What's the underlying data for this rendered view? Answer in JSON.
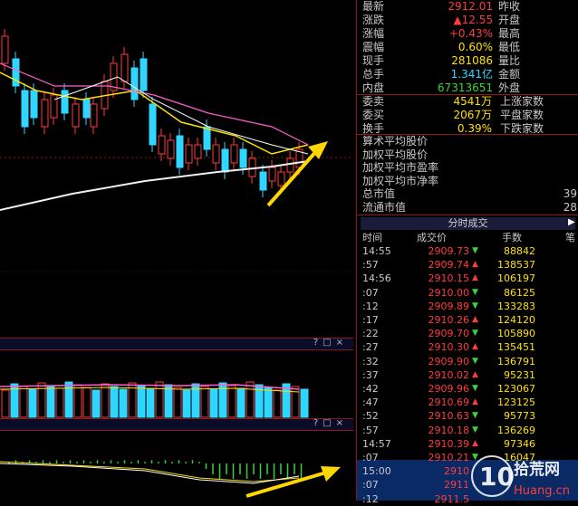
{
  "quote": {
    "rows": [
      {
        "label": "最新",
        "value": "2912.01",
        "color": "#ff3c3c",
        "label2": "昨收"
      },
      {
        "label": "涨跌",
        "value": "▲12.55",
        "color": "#ff3c3c",
        "label2": "开盘"
      },
      {
        "label": "涨幅",
        "value": "+0.43%",
        "color": "#ff3c3c",
        "label2": "最高"
      },
      {
        "label": "震幅",
        "value": "0.60%",
        "color": "#ffe000",
        "label2": "最低"
      },
      {
        "label": "现手",
        "value": "281086",
        "color": "#ffe000",
        "label2": "量比"
      },
      {
        "label": "总手",
        "value": "1.341亿",
        "color": "#2fd6ff",
        "label2": "金额"
      },
      {
        "label": "内盘",
        "value": "67313651",
        "color": "#3cd23c",
        "label2": "外盘"
      }
    ],
    "breadth": [
      {
        "label": "委卖",
        "value": "4541万",
        "label2": "上涨家数"
      },
      {
        "label": "委买",
        "value": "2067万",
        "label2": "平盘家数"
      },
      {
        "label": "换手",
        "value": "0.39%",
        "label2": "下跌家数"
      }
    ]
  },
  "index_info": {
    "rows": [
      "算术平均股价",
      "加权平均股价",
      "加权平均市盈率",
      "加权平均市净率",
      "总市值",
      "流通市值"
    ],
    "total_cap_partial": "39",
    "float_cap_partial": "28"
  },
  "ticks": {
    "title": "分时成交",
    "headers": {
      "time": "时间",
      "price": "成交价",
      "vol": "手数",
      "extra": "笔"
    },
    "rows": [
      {
        "t": "14:55",
        "p": "2909.73",
        "dir": "down",
        "v": "88842"
      },
      {
        "t": ":57",
        "p": "2909.74",
        "dir": "up",
        "v": "138537"
      },
      {
        "t": "14:56",
        "p": "2910.15",
        "dir": "up",
        "v": "106197"
      },
      {
        "t": ":07",
        "p": "2910.00",
        "dir": "down",
        "v": "86125"
      },
      {
        "t": ":12",
        "p": "2909.89",
        "dir": "down",
        "v": "133283"
      },
      {
        "t": ":17",
        "p": "2910.26",
        "dir": "up",
        "v": "124120"
      },
      {
        "t": ":22",
        "p": "2909.70",
        "dir": "down",
        "v": "105890"
      },
      {
        "t": ":27",
        "p": "2910.30",
        "dir": "up",
        "v": "135451"
      },
      {
        "t": ":32",
        "p": "2909.90",
        "dir": "down",
        "v": "136791"
      },
      {
        "t": ":37",
        "p": "2910.02",
        "dir": "up",
        "v": "95231"
      },
      {
        "t": ":42",
        "p": "2909.96",
        "dir": "down",
        "v": "123067"
      },
      {
        "t": ":47",
        "p": "2910.69",
        "dir": "up",
        "v": "123125"
      },
      {
        "t": ":52",
        "p": "2910.63",
        "dir": "down",
        "v": "95773"
      },
      {
        "t": ":57",
        "p": "2910.18",
        "dir": "down",
        "v": "136269"
      },
      {
        "t": "14:57",
        "p": "2910.39",
        "dir": "up",
        "v": "97346"
      },
      {
        "t": ":07",
        "p": "2910.21",
        "dir": "down",
        "v": "16047"
      },
      {
        "t": "15:00",
        "p": "2910",
        "dir": "",
        "v": ""
      },
      {
        "t": ":07",
        "p": "2911",
        "dir": "",
        "v": ""
      },
      {
        "t": ":12",
        "p": "2911.5",
        "dir": "",
        "v": ""
      }
    ]
  },
  "panels": {
    "controls": "?□×"
  },
  "watermark": {
    "num": "10",
    "brand": "拾荒网",
    "domain": "Huang.cn"
  },
  "colors": {
    "up": "#ff3c3c",
    "down": "#2fd6ff",
    "ma5": "#ffffff",
    "ma10": "#ffe000",
    "ma20": "#ff5fd0",
    "ma60": "#e8e8e8",
    "arrow": "#ffd700"
  }
}
